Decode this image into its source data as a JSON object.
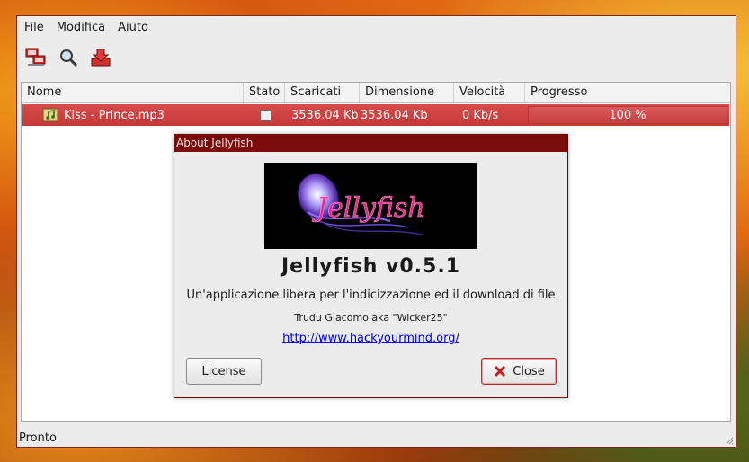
{
  "menu": {
    "items": [
      "File",
      "Modifica",
      "Aiuto"
    ]
  },
  "toolbar": {
    "icons": [
      "network-icon",
      "search-icon",
      "download-icon"
    ]
  },
  "list": {
    "columns": [
      "Nome",
      "Stato",
      "Scaricati",
      "Dimensione",
      "Velocità",
      "Progresso"
    ],
    "rows": [
      {
        "name": "Kiss - Prince.mp3",
        "downloaded": "3536.04 Kb",
        "size": "3536.04 Kb",
        "speed": "0 Kb/s",
        "progress_text": "100 %",
        "progress": 1.0
      }
    ]
  },
  "status": "Pronto",
  "dialog": {
    "title": "About Jellyfish",
    "logo_text": "Jellyfish",
    "app_title": "Jellyfish v0.5.1",
    "description": "Un'applicazione libera per l'indicizzazione ed il download di file",
    "author": "Trudu Giacomo aka \"Wicker25\"",
    "link": "http://www.hackyourmind.org/",
    "license_button": "License",
    "close_button": "Close"
  },
  "colors": {
    "accent": "#c43838",
    "dialog_title": "#7b0c0c",
    "link": "#0000ee"
  }
}
